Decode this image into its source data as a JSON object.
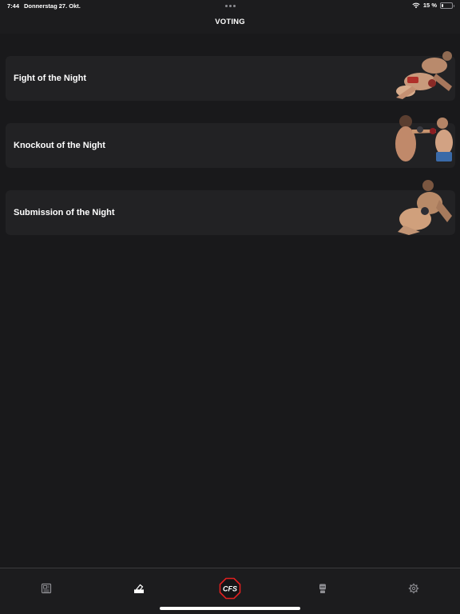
{
  "status_bar": {
    "time": "7:44",
    "date": "Donnerstag 27. Okt.",
    "battery_text": "15 %",
    "battery_level": 0.15
  },
  "nav": {
    "title": "VOTING"
  },
  "cards": [
    {
      "label": "Fight of the Night"
    },
    {
      "label": "Knockout of the Night"
    },
    {
      "label": "Submission of the Night"
    }
  ],
  "tabs": [
    {
      "icon": "news-icon",
      "selected": false
    },
    {
      "icon": "voting-icon",
      "selected": true
    },
    {
      "icon": "cfs-logo-icon",
      "selected": false
    },
    {
      "icon": "fighter-icon",
      "selected": false
    },
    {
      "icon": "gear-icon",
      "selected": false
    }
  ],
  "logo_text": "CFS",
  "colors": {
    "background": "#1c1c1e",
    "card": "#222224",
    "accent": "#e02020",
    "icon_inactive": "#8e8e93"
  }
}
